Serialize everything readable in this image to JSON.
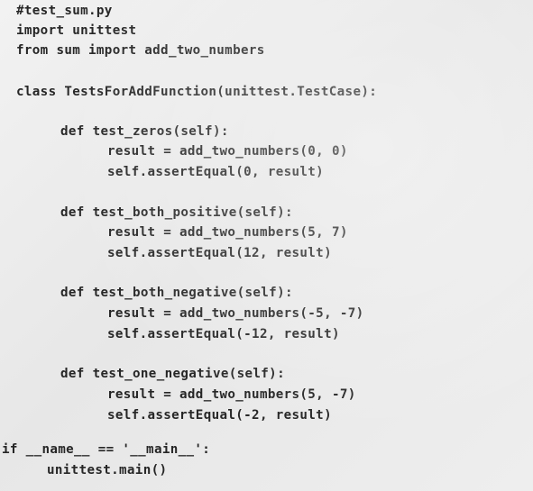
{
  "editor": {
    "filename_comment": "#test_sum.py",
    "lines": [
      "import unittest",
      "from sum import add_two_numbers",
      "",
      "class TestsForAddFunction(unittest.TestCase):",
      "",
      "def test_zeros(self):",
      "result = add_two_numbers(0, 0)",
      "self.assertEqual(0, result)",
      "",
      "def test_both_positive(self):",
      "result = add_two_numbers(5, 7)",
      "self.assertEqual(12, result)",
      "",
      "def test_both_negative(self):",
      "result = add_two_numbers(-5, -7)",
      "self.assertEqual(-12, result)",
      "",
      "def test_one_negative(self):",
      "result = add_two_numbers(5, -7)",
      "self.assertEqual(-2, result)",
      "",
      "if __name__ == '__main__':",
      "unittest.main()"
    ]
  }
}
